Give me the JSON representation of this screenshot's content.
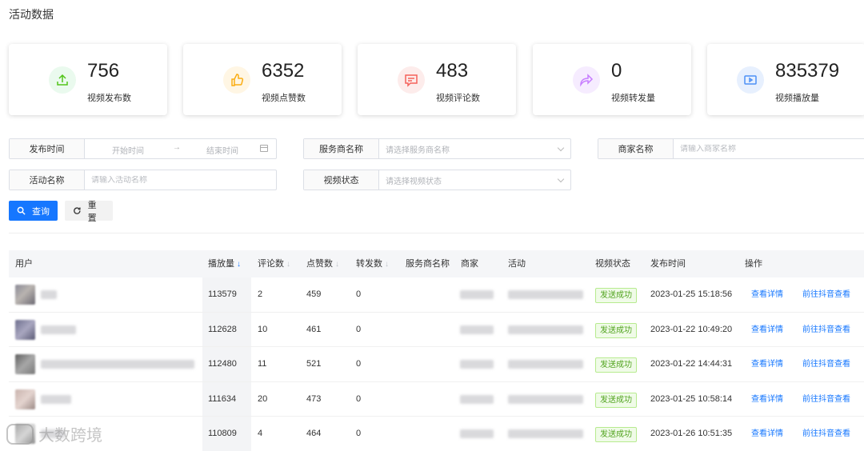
{
  "page": {
    "title": "活动数据"
  },
  "stats": [
    {
      "value": "756",
      "label": "视频发布数",
      "icon": "upload-icon",
      "color": "#52c41a",
      "bg": "#eafaee"
    },
    {
      "value": "6352",
      "label": "视频点赞数",
      "icon": "thumbs-up-icon",
      "color": "#faad14",
      "bg": "#fff6e4"
    },
    {
      "value": "483",
      "label": "视频评论数",
      "icon": "comment-icon",
      "color": "#f5625b",
      "bg": "#fdeceb"
    },
    {
      "value": "0",
      "label": "视频转发量",
      "icon": "share-icon",
      "color": "#c77dff",
      "bg": "#f6ecff"
    },
    {
      "value": "835379",
      "label": "视频播放量",
      "icon": "video-icon",
      "color": "#4d8ff5",
      "bg": "#e7f0fe"
    }
  ],
  "filters": {
    "publish_time": {
      "label": "发布时间",
      "start_placeholder": "开始时间",
      "separator": "→",
      "end_placeholder": "结束时间"
    },
    "service_provider": {
      "label": "服务商名称",
      "placeholder": "请选择服务商名称"
    },
    "merchant": {
      "label": "商家名称",
      "placeholder": "请输入商家名称"
    },
    "activity": {
      "label": "活动名称",
      "placeholder": "请输入活动名称"
    },
    "video_status": {
      "label": "视频状态",
      "placeholder": "请选择视频状态"
    }
  },
  "buttons": {
    "query": "查询",
    "reset": "重置"
  },
  "table": {
    "columns": {
      "user": "用户",
      "plays": "播放量",
      "comments": "评论数",
      "likes": "点赞数",
      "shares": "转发数",
      "service_provider": "服务商名称",
      "merchant": "商家",
      "activity": "活动",
      "status": "视频状态",
      "publish_time": "发布时间",
      "actions": "操作"
    },
    "rows": [
      {
        "plays": "113579",
        "comments": "2",
        "likes": "459",
        "shares": "0",
        "status": "发送成功",
        "time": "2023-01-25 15:18:56",
        "detail": "查看详情",
        "douyin": "前往抖音查看"
      },
      {
        "plays": "112628",
        "comments": "10",
        "likes": "461",
        "shares": "0",
        "status": "发送成功",
        "time": "2023-01-22 10:49:20",
        "detail": "查看详情",
        "douyin": "前往抖音查看"
      },
      {
        "plays": "112480",
        "comments": "11",
        "likes": "521",
        "shares": "0",
        "status": "发送成功",
        "time": "2023-01-22 14:44:31",
        "detail": "查看详情",
        "douyin": "前往抖音查看"
      },
      {
        "plays": "111634",
        "comments": "20",
        "likes": "473",
        "shares": "0",
        "status": "发送成功",
        "time": "2023-01-25 10:58:14",
        "detail": "查看详情",
        "douyin": "前往抖音查看"
      },
      {
        "plays": "110809",
        "comments": "4",
        "likes": "464",
        "shares": "0",
        "status": "发送成功",
        "time": "2023-01-26 10:51:35",
        "detail": "查看详情",
        "douyin": "前往抖音查看"
      }
    ]
  },
  "watermark": {
    "text": "大数跨境"
  }
}
